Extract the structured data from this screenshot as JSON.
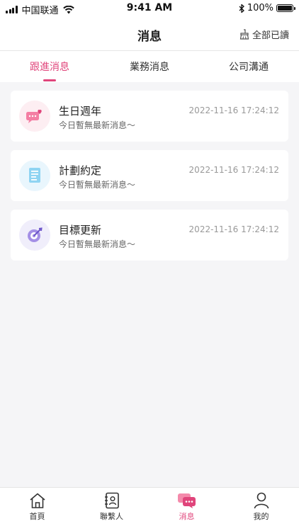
{
  "status_bar": {
    "carrier": "中国联通",
    "time": "9:41 AM",
    "battery": "100%"
  },
  "header": {
    "title": "消息",
    "read_all_label": "全部已讀"
  },
  "tabs": [
    {
      "label": "跟進消息",
      "active": true
    },
    {
      "label": "業務消息",
      "active": false
    },
    {
      "label": "公司溝通",
      "active": false
    }
  ],
  "messages": [
    {
      "name": "生日週年",
      "preview": "今日暫無最新消息～",
      "time": "2022-11-16 17:24:12",
      "icon": "birthday-chat-icon"
    },
    {
      "name": "計劃約定",
      "preview": "今日暫無最新消息～",
      "time": "2022-11-16 17:24:12",
      "icon": "plan-document-icon"
    },
    {
      "name": "目標更新",
      "preview": "今日暫無最新消息～",
      "time": "2022-11-16 17:24:12",
      "icon": "target-icon"
    }
  ],
  "tabbar": [
    {
      "label": "首頁",
      "icon": "home-icon",
      "active": false
    },
    {
      "label": "聯繫人",
      "icon": "contacts-icon",
      "active": false
    },
    {
      "label": "消息",
      "icon": "messages-icon",
      "active": true
    },
    {
      "label": "我的",
      "icon": "profile-icon",
      "active": false
    }
  ],
  "colors": {
    "accent": "#e0457b",
    "background": "#f5f5f7"
  }
}
